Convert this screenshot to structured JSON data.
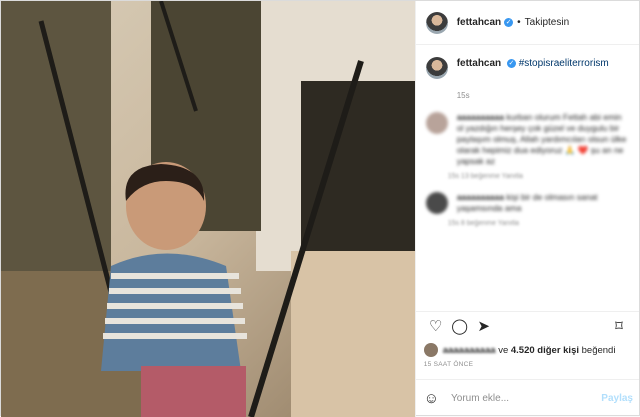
{
  "header": {
    "username": "fettahcan",
    "verified_mark": "✓",
    "dot": "•",
    "follow_label": "Takiptesin"
  },
  "caption": {
    "username": "fettahcan",
    "hashtag": "#stopisraeliterrorism",
    "time": "15s"
  },
  "comments": [
    {
      "username": "aaaaaaaaaa",
      "text": "kurban olurum Fettah abi emin ol yazdığın herşey çok güzel ve duygulu bir paylaşım olmuş, Allah yardımcıları olsun ülke olarak hepimiz dua ediyoruz 🙏 ❤️ şu an ne yapsak az",
      "meta": "15s 13 beğenme Yanıtla",
      "avatar_color": "#b8a39a"
    },
    {
      "username": "aaaaaaaaaa",
      "text": "kişi bir de olmasın sanat yaşamsında ama",
      "meta": "15s 8 beğenme Yanıtla",
      "avatar_color": "#4a4a4a"
    }
  ],
  "actions": {
    "like_icon": "♡",
    "comment_icon": "◯",
    "share_icon": "➤",
    "save_icon": "⌑"
  },
  "likes": {
    "user": "aaaaaaaaaa",
    "conj": "ve",
    "count": "4.520 diğer kişi",
    "suffix": "beğendi"
  },
  "timestamp": "15 SAAT ÖNCE",
  "add_comment": {
    "emoji_icon": "☺",
    "placeholder": "Yorum ekle...",
    "post_label": "Paylaş"
  }
}
